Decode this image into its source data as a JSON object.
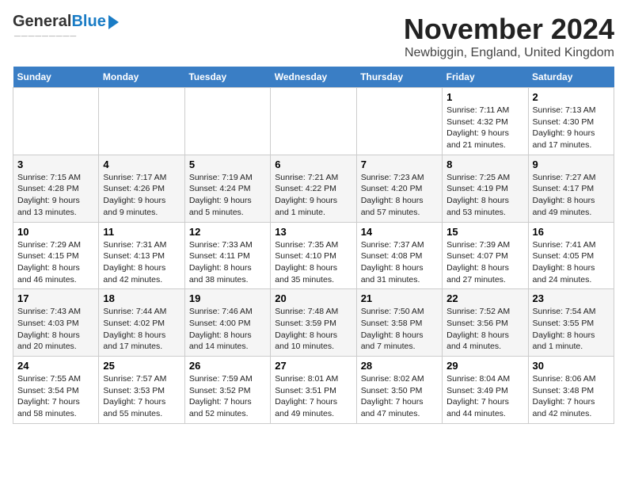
{
  "logo": {
    "general": "General",
    "blue": "Blue"
  },
  "header": {
    "month": "November 2024",
    "location": "Newbiggin, England, United Kingdom"
  },
  "days_of_week": [
    "Sunday",
    "Monday",
    "Tuesday",
    "Wednesday",
    "Thursday",
    "Friday",
    "Saturday"
  ],
  "weeks": [
    [
      {
        "day": "",
        "info": ""
      },
      {
        "day": "",
        "info": ""
      },
      {
        "day": "",
        "info": ""
      },
      {
        "day": "",
        "info": ""
      },
      {
        "day": "",
        "info": ""
      },
      {
        "day": "1",
        "info": "Sunrise: 7:11 AM\nSunset: 4:32 PM\nDaylight: 9 hours\nand 21 minutes."
      },
      {
        "day": "2",
        "info": "Sunrise: 7:13 AM\nSunset: 4:30 PM\nDaylight: 9 hours\nand 17 minutes."
      }
    ],
    [
      {
        "day": "3",
        "info": "Sunrise: 7:15 AM\nSunset: 4:28 PM\nDaylight: 9 hours\nand 13 minutes."
      },
      {
        "day": "4",
        "info": "Sunrise: 7:17 AM\nSunset: 4:26 PM\nDaylight: 9 hours\nand 9 minutes."
      },
      {
        "day": "5",
        "info": "Sunrise: 7:19 AM\nSunset: 4:24 PM\nDaylight: 9 hours\nand 5 minutes."
      },
      {
        "day": "6",
        "info": "Sunrise: 7:21 AM\nSunset: 4:22 PM\nDaylight: 9 hours\nand 1 minute."
      },
      {
        "day": "7",
        "info": "Sunrise: 7:23 AM\nSunset: 4:20 PM\nDaylight: 8 hours\nand 57 minutes."
      },
      {
        "day": "8",
        "info": "Sunrise: 7:25 AM\nSunset: 4:19 PM\nDaylight: 8 hours\nand 53 minutes."
      },
      {
        "day": "9",
        "info": "Sunrise: 7:27 AM\nSunset: 4:17 PM\nDaylight: 8 hours\nand 49 minutes."
      }
    ],
    [
      {
        "day": "10",
        "info": "Sunrise: 7:29 AM\nSunset: 4:15 PM\nDaylight: 8 hours\nand 46 minutes."
      },
      {
        "day": "11",
        "info": "Sunrise: 7:31 AM\nSunset: 4:13 PM\nDaylight: 8 hours\nand 42 minutes."
      },
      {
        "day": "12",
        "info": "Sunrise: 7:33 AM\nSunset: 4:11 PM\nDaylight: 8 hours\nand 38 minutes."
      },
      {
        "day": "13",
        "info": "Sunrise: 7:35 AM\nSunset: 4:10 PM\nDaylight: 8 hours\nand 35 minutes."
      },
      {
        "day": "14",
        "info": "Sunrise: 7:37 AM\nSunset: 4:08 PM\nDaylight: 8 hours\nand 31 minutes."
      },
      {
        "day": "15",
        "info": "Sunrise: 7:39 AM\nSunset: 4:07 PM\nDaylight: 8 hours\nand 27 minutes."
      },
      {
        "day": "16",
        "info": "Sunrise: 7:41 AM\nSunset: 4:05 PM\nDaylight: 8 hours\nand 24 minutes."
      }
    ],
    [
      {
        "day": "17",
        "info": "Sunrise: 7:43 AM\nSunset: 4:03 PM\nDaylight: 8 hours\nand 20 minutes."
      },
      {
        "day": "18",
        "info": "Sunrise: 7:44 AM\nSunset: 4:02 PM\nDaylight: 8 hours\nand 17 minutes."
      },
      {
        "day": "19",
        "info": "Sunrise: 7:46 AM\nSunset: 4:00 PM\nDaylight: 8 hours\nand 14 minutes."
      },
      {
        "day": "20",
        "info": "Sunrise: 7:48 AM\nSunset: 3:59 PM\nDaylight: 8 hours\nand 10 minutes."
      },
      {
        "day": "21",
        "info": "Sunrise: 7:50 AM\nSunset: 3:58 PM\nDaylight: 8 hours\nand 7 minutes."
      },
      {
        "day": "22",
        "info": "Sunrise: 7:52 AM\nSunset: 3:56 PM\nDaylight: 8 hours\nand 4 minutes."
      },
      {
        "day": "23",
        "info": "Sunrise: 7:54 AM\nSunset: 3:55 PM\nDaylight: 8 hours\nand 1 minute."
      }
    ],
    [
      {
        "day": "24",
        "info": "Sunrise: 7:55 AM\nSunset: 3:54 PM\nDaylight: 7 hours\nand 58 minutes."
      },
      {
        "day": "25",
        "info": "Sunrise: 7:57 AM\nSunset: 3:53 PM\nDaylight: 7 hours\nand 55 minutes."
      },
      {
        "day": "26",
        "info": "Sunrise: 7:59 AM\nSunset: 3:52 PM\nDaylight: 7 hours\nand 52 minutes."
      },
      {
        "day": "27",
        "info": "Sunrise: 8:01 AM\nSunset: 3:51 PM\nDaylight: 7 hours\nand 49 minutes."
      },
      {
        "day": "28",
        "info": "Sunrise: 8:02 AM\nSunset: 3:50 PM\nDaylight: 7 hours\nand 47 minutes."
      },
      {
        "day": "29",
        "info": "Sunrise: 8:04 AM\nSunset: 3:49 PM\nDaylight: 7 hours\nand 44 minutes."
      },
      {
        "day": "30",
        "info": "Sunrise: 8:06 AM\nSunset: 3:48 PM\nDaylight: 7 hours\nand 42 minutes."
      }
    ]
  ]
}
